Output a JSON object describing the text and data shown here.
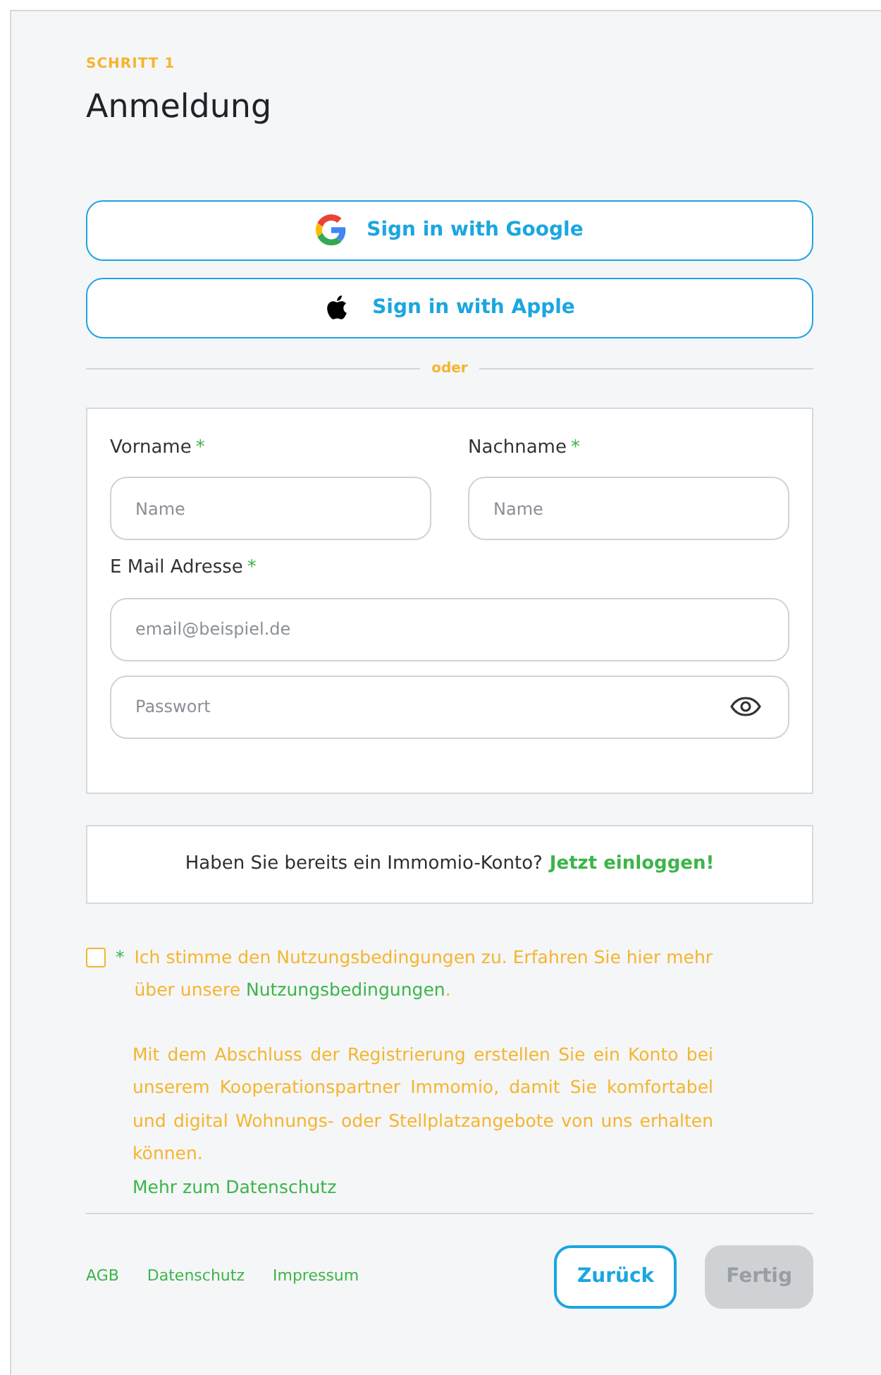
{
  "step": "SCHRITT 1",
  "title": "Anmeldung",
  "social_buttons": [
    {
      "kind": "google",
      "label": "Sign in with Google"
    },
    {
      "kind": "apple",
      "label": "Sign in with Apple"
    }
  ],
  "divider_label": "oder",
  "form": {
    "rows": [
      [
        {
          "label": "Vorname",
          "required_mark": "*",
          "placeholder": "Name",
          "kind": "text"
        },
        {
          "label": "Nachname",
          "required_mark": "*",
          "placeholder": "Name",
          "kind": "text"
        }
      ],
      [
        {
          "label": "E Mail Adresse",
          "required_mark": "*",
          "placeholder": "email@beispiel.de",
          "kind": "text"
        }
      ],
      [
        {
          "placeholder": "Passwort",
          "kind": "password"
        }
      ]
    ]
  },
  "login_box": {
    "text": "Haben Sie bereits ein Immomio-Konto?",
    "link": "Jetzt einloggen!"
  },
  "terms": {
    "checked": false,
    "required_mark": "*",
    "text": "Ich stimme den Nutzungsbedingungen zu. Erfahren Sie hier mehr über unsere ",
    "link": "Nutzungsbedingungen",
    "text_end": "."
  },
  "privacy_text": "Mit dem Abschluss der Registrierung erstellen Sie ein Konto bei unserem Kooperationspartner Immomio, damit Sie komfortabel und digital Wohnungs- oder Stellplatzangebote von uns erhalten können.",
  "privacy_link": "Mehr zum Datenschutz",
  "footer_links": [
    "AGB",
    "Datenschutz",
    "Impressum"
  ],
  "buttons": [
    {
      "label": "Zurück",
      "disabled": false
    },
    {
      "label": "Fertig",
      "disabled": true
    }
  ]
}
